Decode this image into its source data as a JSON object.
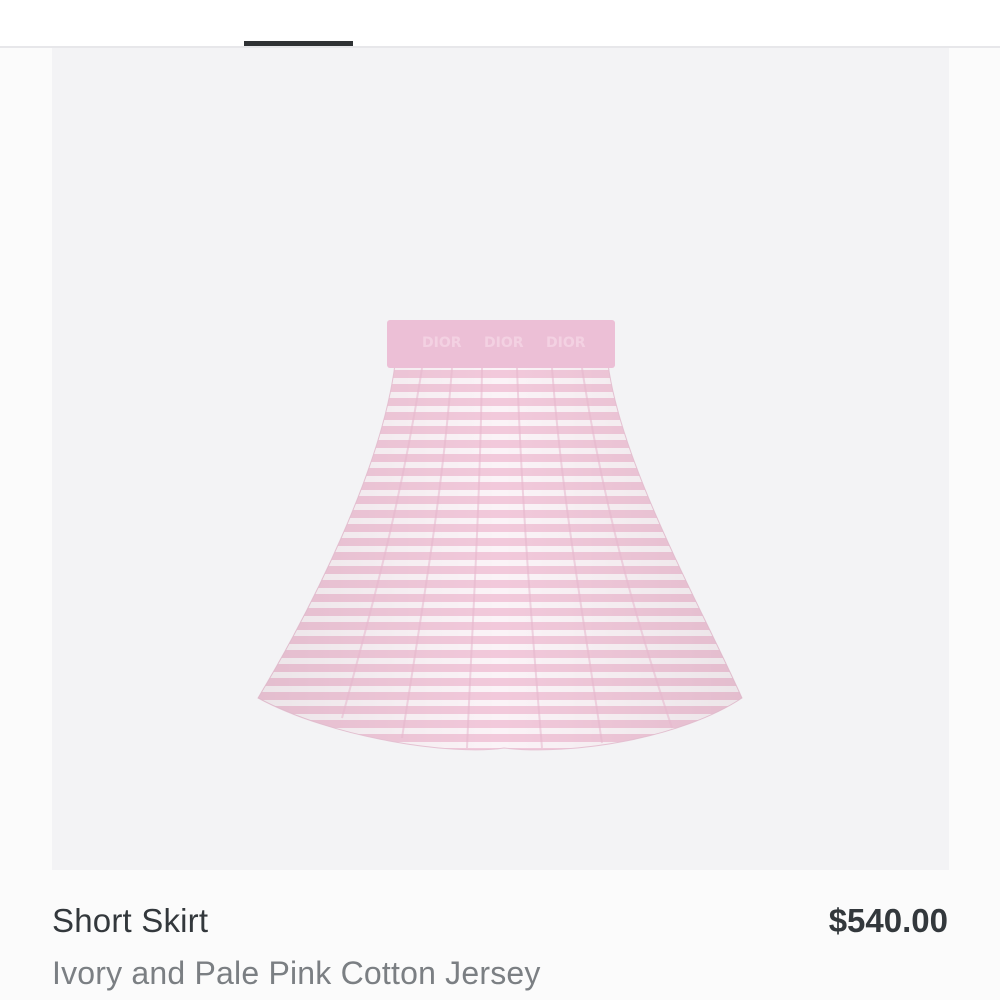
{
  "product": {
    "title": "Short Skirt",
    "price": "$540.00",
    "subtitle": "Ivory and Pale Pink Cotton Jersey",
    "image_icon": "skirt-image",
    "waistband_text": "DIOR"
  },
  "colors": {
    "panel_bg": "#f3f3f5",
    "skirt_pink": "#f2c9db",
    "skirt_ivory": "#fbf3f7",
    "waistband": "#ecbfd6",
    "text_dark": "#33383c",
    "text_muted": "#7b7f83",
    "indicator": "#2f3234"
  }
}
